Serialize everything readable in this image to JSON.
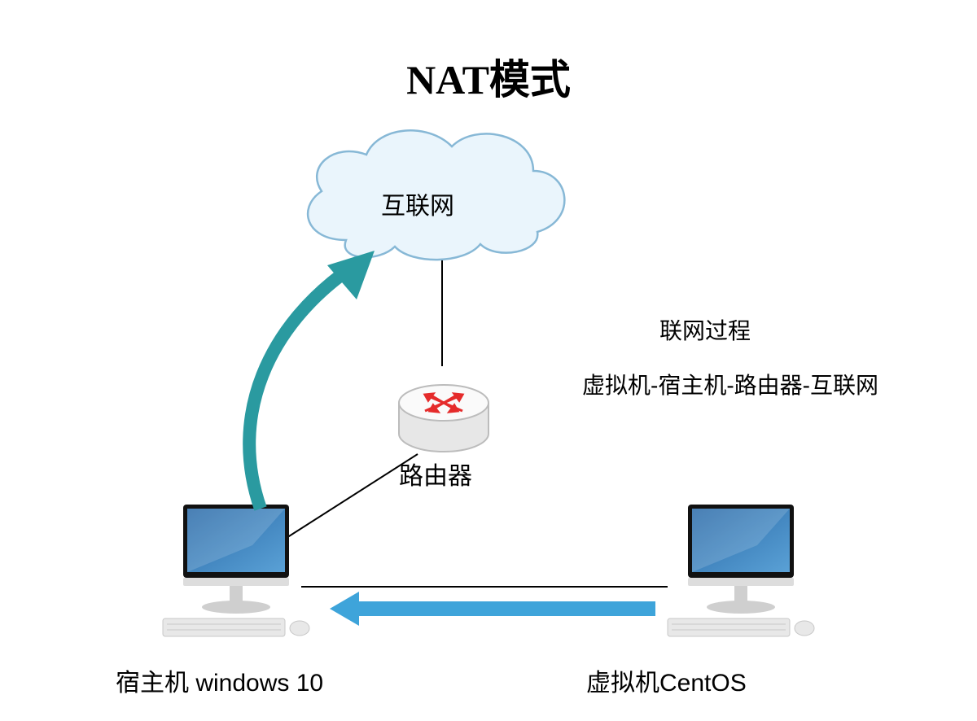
{
  "title": "NAT模式",
  "nodes": {
    "internet": "互联网",
    "router": "路由器",
    "host": "宿主机 windows 10",
    "vm": "虚拟机CentOS"
  },
  "side": {
    "header": "联网过程",
    "path": "虚拟机-宿主机-路由器-互联网"
  },
  "colors": {
    "blue_arrow": "#3ea4da",
    "teal_arrow": "#2a9aa0",
    "router_red": "#e52b2b",
    "cloud_fill": "#eaf5fc",
    "cloud_stroke": "#87b8d6",
    "screen1": "#2a6aa8",
    "screen2": "#5aa1d6"
  },
  "flow": [
    "vm",
    "host",
    "router",
    "internet"
  ],
  "icons": {
    "cloud": "cloud-icon",
    "router": "router-icon",
    "computer": "desktop-computer-icon",
    "arrow_left": "arrow-left-icon",
    "arrow_up_curve": "curved-arrow-up-icon"
  }
}
